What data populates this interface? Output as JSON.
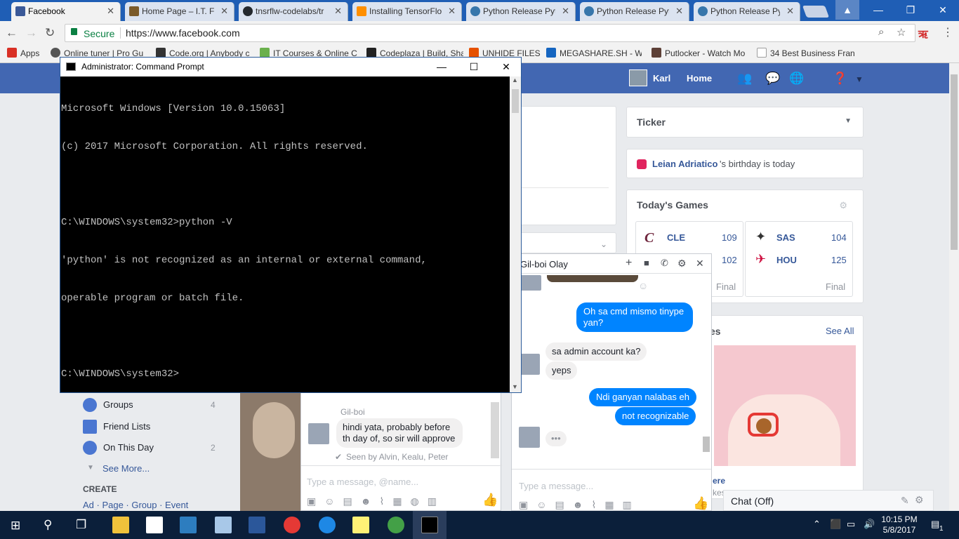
{
  "browser": {
    "tabs": [
      {
        "label": "Facebook",
        "color": "#3b5998"
      },
      {
        "label": "Home Page – I.T. Fi",
        "color": "#7a5a2a"
      },
      {
        "label": "tnsrflw-codelabs/tr",
        "color": "#24292e"
      },
      {
        "label": "Installing TensorFlo",
        "color": "#ff8f00"
      },
      {
        "label": "Python Release Pyt",
        "color": "#3776ab"
      },
      {
        "label": "Python Release Pyt",
        "color": "#3776ab"
      },
      {
        "label": "Python Release Pyt",
        "color": "#3776ab"
      }
    ],
    "secure_label": "Secure",
    "url": "https://www.facebook.com",
    "bookmarks": [
      {
        "label": "Apps",
        "color": "#d93025"
      },
      {
        "label": "Online tuner | Pro Gu",
        "color": "#555555"
      },
      {
        "label": "Code.org | Anybody c",
        "color": "#333333"
      },
      {
        "label": "IT Courses & Online C",
        "color": "#6ab04c"
      },
      {
        "label": "Codeplaza | Build, Sha",
        "color": "#222222"
      },
      {
        "label": "UNHIDE FILES",
        "color": "#e65100"
      },
      {
        "label": "MEGASHARE.SH - Wa",
        "color": "#1565c0"
      },
      {
        "label": "Putlocker - Watch Mo",
        "color": "#5d4037"
      },
      {
        "label": "34 Best Business Franc",
        "color": "#9e9e9e"
      }
    ]
  },
  "facebook": {
    "user_name": "Karl",
    "home_label": "Home",
    "ticker_title": "Ticker",
    "birthday_name": "Leian Adriatico",
    "birthday_rest": "'s birthday is today",
    "games_title": "Today's Games",
    "game1": {
      "team1": "CLE",
      "score1": "109",
      "score2": "102",
      "status": "Final"
    },
    "game2": {
      "team1": "SAS",
      "score1": "104",
      "team2": "HOU",
      "score2": "125",
      "status": "Final"
    },
    "trending_fragment": "es",
    "see_all": "See All",
    "ere_fragment": "ere",
    "kes_fragment": "kes",
    "left_nav": [
      {
        "label": "Groups",
        "count": "4"
      },
      {
        "label": "Friend Lists",
        "count": ""
      },
      {
        "label": "On This Day",
        "count": "2"
      },
      {
        "label": "See More...",
        "count": ""
      }
    ],
    "create_label": "CREATE",
    "create_links": "Ad · Page · Group · Event",
    "chat_off": "Chat (Off)"
  },
  "chat_left": {
    "sender": "Gil-boi",
    "message": "hindi yata, probably before th day of, so sir will approve",
    "seen": "Seen by Alvin, Kealu, Peter",
    "input_placeholder": "Type a message, @name..."
  },
  "chat_right": {
    "title": "Gil-boi Olay",
    "messages": [
      {
        "text": "Oh sa cmd mismo tinype yan?",
        "from": "me"
      },
      {
        "text": "sa admin account ka?",
        "from": "them"
      },
      {
        "text": "yeps",
        "from": "them"
      },
      {
        "text": "Ndi ganyan nalabas eh",
        "from": "me"
      },
      {
        "text": "not recognizable",
        "from": "me"
      }
    ],
    "typing": "•••",
    "input_placeholder": "Type a message..."
  },
  "cmd": {
    "title": "Administrator: Command Prompt",
    "lines": [
      "Microsoft Windows [Version 10.0.15063]",
      "(c) 2017 Microsoft Corporation. All rights reserved.",
      "",
      "C:\\WINDOWS\\system32>python -V",
      "'python' is not recognized as an internal or external command,",
      "operable program or batch file.",
      "",
      "C:\\WINDOWS\\system32>"
    ]
  },
  "taskbar": {
    "time": "10:15 PM",
    "date": "5/8/2017",
    "notification_count": "1"
  }
}
